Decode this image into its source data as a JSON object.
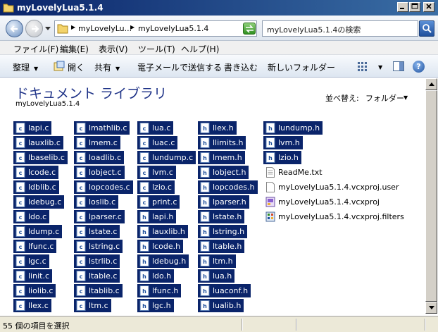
{
  "window": {
    "title": "myLovelyLua5.1.4"
  },
  "address": {
    "crumbs": [
      "myLovelyLu...",
      "myLovelyLua5.1.4"
    ],
    "search_placeholder": "myLovelyLua5.1.4の検索"
  },
  "menu": [
    "ファイル(F)",
    "編集(E)",
    "表示(V)",
    "ツール(T)",
    "ヘルプ(H)"
  ],
  "commands": {
    "organize": "整理",
    "open": "開く",
    "share": "共有",
    "email": "電子メールで送信する",
    "burn": "書き込む",
    "new_folder": "新しいフォルダー"
  },
  "library": {
    "title": "ドキュメント ライブラリ",
    "subtitle": "myLovelyLua5.1.4",
    "sort_label": "並べ替え:",
    "sort_value": "フォルダー"
  },
  "columns": [
    [
      {
        "name": "lapi.c",
        "type": "c"
      },
      {
        "name": "lauxlib.c",
        "type": "c"
      },
      {
        "name": "lbaselib.c",
        "type": "c"
      },
      {
        "name": "lcode.c",
        "type": "c"
      },
      {
        "name": "ldblib.c",
        "type": "c"
      },
      {
        "name": "ldebug.c",
        "type": "c"
      },
      {
        "name": "ldo.c",
        "type": "c"
      },
      {
        "name": "ldump.c",
        "type": "c"
      },
      {
        "name": "lfunc.c",
        "type": "c"
      },
      {
        "name": "lgc.c",
        "type": "c"
      },
      {
        "name": "linit.c",
        "type": "c"
      },
      {
        "name": "liolib.c",
        "type": "c"
      },
      {
        "name": "llex.c",
        "type": "c"
      }
    ],
    [
      {
        "name": "lmathlib.c",
        "type": "c"
      },
      {
        "name": "lmem.c",
        "type": "c"
      },
      {
        "name": "loadlib.c",
        "type": "c"
      },
      {
        "name": "lobject.c",
        "type": "c"
      },
      {
        "name": "lopcodes.c",
        "type": "c"
      },
      {
        "name": "loslib.c",
        "type": "c"
      },
      {
        "name": "lparser.c",
        "type": "c"
      },
      {
        "name": "lstate.c",
        "type": "c"
      },
      {
        "name": "lstring.c",
        "type": "c"
      },
      {
        "name": "lstrlib.c",
        "type": "c"
      },
      {
        "name": "ltable.c",
        "type": "c"
      },
      {
        "name": "ltablib.c",
        "type": "c"
      },
      {
        "name": "ltm.c",
        "type": "c"
      }
    ],
    [
      {
        "name": "lua.c",
        "type": "c"
      },
      {
        "name": "luac.c",
        "type": "c"
      },
      {
        "name": "lundump.c",
        "type": "c"
      },
      {
        "name": "lvm.c",
        "type": "c"
      },
      {
        "name": "lzio.c",
        "type": "c"
      },
      {
        "name": "print.c",
        "type": "c"
      },
      {
        "name": "lapi.h",
        "type": "h"
      },
      {
        "name": "lauxlib.h",
        "type": "h"
      },
      {
        "name": "lcode.h",
        "type": "h"
      },
      {
        "name": "ldebug.h",
        "type": "h"
      },
      {
        "name": "ldo.h",
        "type": "h"
      },
      {
        "name": "lfunc.h",
        "type": "h"
      },
      {
        "name": "lgc.h",
        "type": "h"
      }
    ],
    [
      {
        "name": "llex.h",
        "type": "h"
      },
      {
        "name": "llimits.h",
        "type": "h"
      },
      {
        "name": "lmem.h",
        "type": "h"
      },
      {
        "name": "lobject.h",
        "type": "h"
      },
      {
        "name": "lopcodes.h",
        "type": "h"
      },
      {
        "name": "lparser.h",
        "type": "h"
      },
      {
        "name": "lstate.h",
        "type": "h"
      },
      {
        "name": "lstring.h",
        "type": "h"
      },
      {
        "name": "ltable.h",
        "type": "h"
      },
      {
        "name": "ltm.h",
        "type": "h"
      },
      {
        "name": "lua.h",
        "type": "h"
      },
      {
        "name": "luaconf.h",
        "type": "h"
      },
      {
        "name": "lualib.h",
        "type": "h"
      }
    ],
    [
      {
        "name": "lundump.h",
        "type": "h"
      },
      {
        "name": "lvm.h",
        "type": "h"
      },
      {
        "name": "lzio.h",
        "type": "h"
      },
      {
        "name": "ReadMe.txt",
        "type": "txt"
      },
      {
        "name": "myLovelyLua5.1.4.vcxproj.user",
        "type": "user"
      },
      {
        "name": "myLovelyLua5.1.4.vcxproj",
        "type": "proj"
      },
      {
        "name": "myLovelyLua5.1.4.vcxproj.filters",
        "type": "filters"
      }
    ]
  ],
  "status": {
    "text": "55 個の項目を選択"
  }
}
